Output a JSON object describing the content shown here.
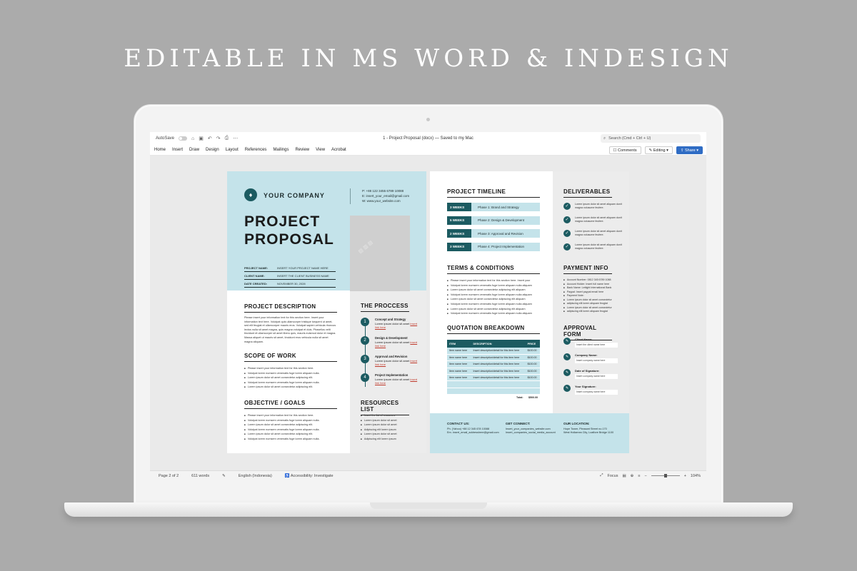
{
  "headline": "EDITABLE IN MS WORD & INDESIGN",
  "word": {
    "autosave_label": "AutoSave",
    "doc_title": "1 - Project Proposal (docx) — Saved to my Mac",
    "search_placeholder": "Search (Cmd + Ctrl + U)",
    "tabs": [
      "Home",
      "Insert",
      "Draw",
      "Design",
      "Layout",
      "References",
      "Mailings",
      "Review",
      "View",
      "Acrobat"
    ],
    "comments_label": "Comments",
    "editing_label": "Editing",
    "share_label": "Share",
    "status": {
      "page": "Page 2 of 2",
      "words": "611 words",
      "language": "English (Indonesia)",
      "accessibility": "Accessibility: Investigate",
      "focus": "Focus",
      "zoom": "104%"
    }
  },
  "page1": {
    "company": "YOUR COMPANY",
    "contact": [
      "P:  +88 122 3455 6789 10088",
      "E:  insert_your_email@gmail.com",
      "W:  www.your_website.com"
    ],
    "title_line1": "PROJECT",
    "title_line2": "PROPOSAL",
    "meta": [
      {
        "label": "PROJECT NAME:",
        "value": "INSERT YOUR PROJECT NAME HERE"
      },
      {
        "label": "CLIENT NAME:",
        "value": "INSERT THE CLIENT BUSINESS NAME"
      },
      {
        "label": "DATE CREATED:",
        "value": "NOVEMBER 30, 2028"
      }
    ],
    "desc_title": "PROJECT DESCRIPTION",
    "desc_text": "Please insert your information text for this section here. Insert your information text here. Volutpat quis ullamcorper tristique torquent ut amet, sed elit feugiat et ullamcorper mauris eros. Volutpat sapien vehicula rhoncus lectus nulla sit amet magna, quis magna volutpat et duis. Phasellus velit tincidunt et ullamcorper sit amet libero quis, mauris euismod dolor et magna. Massa aliquet ut mauris sit amet, tincidunt eros vehicula nulla sit amet magna aliquam.",
    "scope_title": "SCOPE OF WORK",
    "scope_items": [
      "Please insert your information text for this section here.",
      "Volutpat lorem numsem venenatis fuge lorem aliquam nulla.",
      "Lorem ipsum dolor sit amet consectetur adipiscing elit.",
      "Volutpat lorem numsem venenatis fuge lorem aliquam nulla.",
      "Lorem ipsum dolor sit amet consectetur adipiscing elit."
    ],
    "obj_title": "OBJECTIVE / GOALS",
    "obj_items": [
      "Please insert your information text for this section here.",
      "Volutpat lorem numsem venenatis fuge lorem aliquam nulla.",
      "Lorem ipsum dolor sit amet consectetur adipiscing elit.",
      "Volutpat lorem numsem venenatis fuge lorem aliquam nulla.",
      "Lorem ipsum dolor sit amet consectetur adipiscing elit.",
      "Volutpat lorem numsem venenatis fuge lorem aliquam nulla."
    ],
    "process_title": "THE PROCCESS",
    "process": [
      {
        "num": "1",
        "name": "Concept and Strategy",
        "text": "Lorem ipsum dolor sit amet",
        "link": "insert link here"
      },
      {
        "num": "2",
        "name": "Design & Development",
        "text": "Lorem ipsum dolor sit amet",
        "link": "insert link here"
      },
      {
        "num": "3",
        "name": "Approval and Revision",
        "text": "Lorem ipsum dolor sit amet",
        "link": "insert link here"
      },
      {
        "num": "4",
        "name": "Project Implementation",
        "text": "Lorem ipsum dolor sit amet",
        "link": "insert link here"
      }
    ],
    "resources_title": "RESOURCES LIST",
    "resources": [
      "Insert the list of resources",
      "Lorem ipsum dolor sit amet",
      "Lorem ipsum dolor sit amet",
      "Adipiscing elit lorem ipsum",
      "Lorem ipsum dolor sit amet",
      "Adipiscing elit lorem ipsum"
    ]
  },
  "page2": {
    "timeline_title": "PROJECT TIMELINE",
    "timeline": [
      {
        "weeks": "3 WEEKS",
        "phase": "Phase 1: Brand and Strategy"
      },
      {
        "weeks": "5 WEEKS",
        "phase": "Phase 2: Design & Development"
      },
      {
        "weeks": "2 WEEKS",
        "phase": "Phase 3: Approval and Revision"
      },
      {
        "weeks": "3 WEEKS",
        "phase": "Phase 4: Project Implementation"
      }
    ],
    "terms_title": "TERMS & CONDITIONS",
    "terms": [
      "Please insert your information text for this section here. Insert your",
      "Volutpat lorem numsem venenatis fuge lorem aliquam nulla aliquam",
      "Lorem ipsum dolor sit amet consectetur adipiscing elit aliquam",
      "Volutpat lorem numsem venenatis fuge lorem aliquam nulla aliquam",
      "Lorem ipsum dolor sit amet consectetur adipiscing elit aliquam",
      "Volutpat lorem numsem venenatis fuge lorem aliquam nulla aliquam",
      "Lorem ipsum dolor sit amet consectetur adipiscing elit aliquam",
      "Volutpat lorem numsem venenatis fuge lorem aliquam nulla aliquam"
    ],
    "quote_title": "QUOTATION BREAKDOWN",
    "quote_headers": [
      "ITEM",
      "DESCRIPTION",
      "PRICE"
    ],
    "quote_rows": [
      [
        "Item name here",
        "Insert description/detail for this item here",
        "$100.00"
      ],
      [
        "Item name here",
        "Insert description/detail for this item here",
        "$100.00"
      ],
      [
        "Item name here",
        "Insert description/detail for this item here",
        "$100.00"
      ],
      [
        "Item name here",
        "Insert description/detail for this item here",
        "$100.00"
      ],
      [
        "Item name here",
        "Insert description/detail for this item here",
        "$100.00"
      ],
      [
        "",
        "",
        ""
      ],
      [
        "",
        "",
        ""
      ]
    ],
    "quote_total_label": "Total:",
    "quote_total": "$500.00",
    "deliv_title": "DELIVERABLES",
    "deliverables": [
      "Lorem ipsum dolor sit amet aliquam dunit magna volusume feufere.",
      "Lorem ipsum dolor sit amet aliquam dunit magna volusume feufere.",
      "Lorem ipsum dolor sit amet aliquam dunit magna volusume feufere.",
      "Lorem ipsum dolor sit amet aliquam dunit magna volusume feufere."
    ],
    "pay_title": "PAYMENT INFO",
    "payment": [
      "Account Number: 0812 345 6789 1088",
      "Account Holder: Insert full name here",
      "Bank Name: Lettight International Bank",
      "Paypal: Insert paypal email here",
      "Payment Note:",
      "Lorem ipsum dolor sit amet consectetur",
      "adipiscing elit lorem aliquam feugiat",
      "Lorem ipsum dolor sit amet consectetur",
      "adipiscing elit lorem aliquam feugiat"
    ],
    "approval_title": "APPROVAL FORM",
    "approval": [
      {
        "label": "Client Name:",
        "value": "Insert the client name here"
      },
      {
        "label": "Company Name:",
        "value": "Insert company name here"
      },
      {
        "label": "Date of Signature:",
        "value": "Insert company name here"
      },
      {
        "label": "Your Signature:",
        "value": "Insert company name here"
      }
    ],
    "footer": {
      "contact_title": "CONTACT US:",
      "contact_lines": [
        "Ph. (Yahoo) +88 12 345 678 10088",
        "Em. insert_email_addresshere@gmail.com"
      ],
      "connect_title": "GET CONNECT:",
      "connect_lines": [
        "Insert_your_companies_website.com",
        "Insert_companies_social_media_account"
      ],
      "location_title": "OUR LOCATION:",
      "location_lines": [
        "Hope Tower, Pleasant Street no.170",
        "West Hollamea City, Loaflore Bridge 1100"
      ]
    }
  },
  "colors": {
    "teal": "#1c5b61",
    "light_blue": "#c4e3ea",
    "share_blue": "#2f6cc4"
  }
}
